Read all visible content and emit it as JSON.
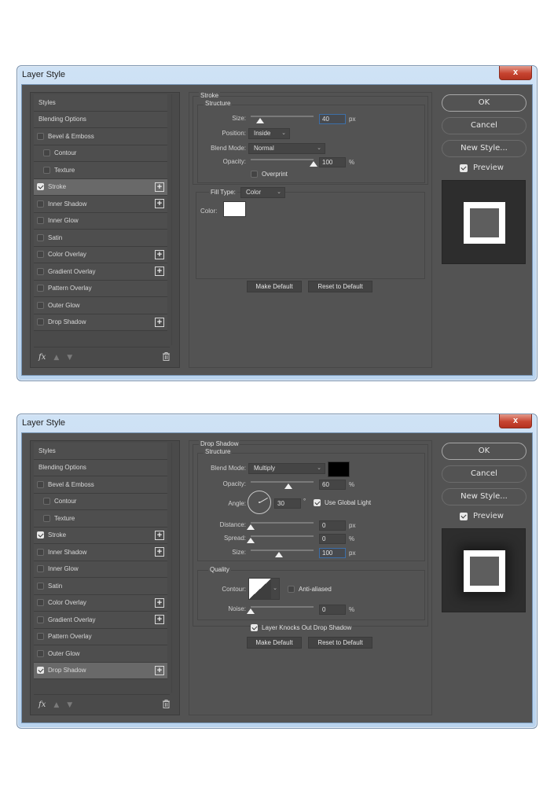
{
  "dialogs": [
    {
      "title": "Layer Style",
      "close_label": "x",
      "styles_list": [
        {
          "label": "Styles",
          "type": "plain"
        },
        {
          "label": "Blending Options",
          "type": "plain"
        },
        {
          "label": "Bevel & Emboss",
          "checked": false
        },
        {
          "label": "Contour",
          "checked": false,
          "sub": true
        },
        {
          "label": "Texture",
          "checked": false,
          "sub": true
        },
        {
          "label": "Stroke",
          "checked": true,
          "plus": true,
          "active": true
        },
        {
          "label": "Inner Shadow",
          "checked": false,
          "plus": true
        },
        {
          "label": "Inner Glow",
          "checked": false
        },
        {
          "label": "Satin",
          "checked": false
        },
        {
          "label": "Color Overlay",
          "checked": false,
          "plus": true
        },
        {
          "label": "Gradient Overlay",
          "checked": false,
          "plus": true
        },
        {
          "label": "Pattern Overlay",
          "checked": false
        },
        {
          "label": "Outer Glow",
          "checked": false
        },
        {
          "label": "Drop Shadow",
          "checked": false,
          "plus": true
        }
      ],
      "footer": {
        "fx_label": "fx",
        "up_icon": "▲",
        "down_icon": "▼",
        "trash_icon": "🗑"
      },
      "panel": {
        "section_title": "Stroke",
        "structure_title": "Structure",
        "size_label": "Size:",
        "size_value": "40",
        "size_unit": "px",
        "size_slider_fraction": 0.15,
        "position_label": "Position:",
        "position_value": "Inside",
        "blend_mode_label": "Blend Mode:",
        "blend_mode_value": "Normal",
        "opacity_label": "Opacity:",
        "opacity_value": "100",
        "opacity_unit": "%",
        "opacity_slider_fraction": 1.0,
        "overprint_label": "Overprint",
        "overprint_checked": false,
        "fill_type_label": "Fill Type:",
        "fill_type_value": "Color",
        "color_label": "Color:",
        "color_value": "#ffffff",
        "make_default": "Make Default",
        "reset_default": "Reset to Default"
      },
      "buttons": {
        "ok": "OK",
        "cancel": "Cancel",
        "new_style": "New Style...",
        "preview": "Preview",
        "preview_checked": true
      }
    },
    {
      "title": "Layer Style",
      "close_label": "x",
      "styles_list": [
        {
          "label": "Styles",
          "type": "plain"
        },
        {
          "label": "Blending Options",
          "type": "plain"
        },
        {
          "label": "Bevel & Emboss",
          "checked": false
        },
        {
          "label": "Contour",
          "checked": false,
          "sub": true
        },
        {
          "label": "Texture",
          "checked": false,
          "sub": true
        },
        {
          "label": "Stroke",
          "checked": true,
          "plus": true
        },
        {
          "label": "Inner Shadow",
          "checked": false,
          "plus": true
        },
        {
          "label": "Inner Glow",
          "checked": false
        },
        {
          "label": "Satin",
          "checked": false
        },
        {
          "label": "Color Overlay",
          "checked": false,
          "plus": true
        },
        {
          "label": "Gradient Overlay",
          "checked": false,
          "plus": true
        },
        {
          "label": "Pattern Overlay",
          "checked": false
        },
        {
          "label": "Outer Glow",
          "checked": false
        },
        {
          "label": "Drop Shadow",
          "checked": true,
          "plus": true,
          "active": true
        }
      ],
      "footer": {
        "fx_label": "fx",
        "up_icon": "▲",
        "down_icon": "▼",
        "trash_icon": "🗑"
      },
      "panel": {
        "section_title": "Drop Shadow",
        "structure_title": "Structure",
        "blend_mode_label": "Blend Mode:",
        "blend_mode_value": "Multiply",
        "shadow_color": "#000000",
        "opacity_label": "Opacity:",
        "opacity_value": "60",
        "opacity_unit": "%",
        "opacity_slider_fraction": 0.6,
        "angle_label": "Angle:",
        "angle_value": "30",
        "angle_unit": "°",
        "global_light_label": "Use Global Light",
        "global_light_checked": true,
        "distance_label": "Distance:",
        "distance_value": "0",
        "distance_unit": "px",
        "distance_slider_fraction": 0,
        "spread_label": "Spread:",
        "spread_value": "0",
        "spread_unit": "%",
        "spread_slider_fraction": 0,
        "size_label": "Size:",
        "size_value": "100",
        "size_unit": "px",
        "size_slider_fraction": 0.45,
        "quality_title": "Quality",
        "contour_label": "Contour:",
        "anti_aliased_label": "Anti-aliased",
        "anti_aliased_checked": false,
        "noise_label": "Noise:",
        "noise_value": "0",
        "noise_unit": "%",
        "noise_slider_fraction": 0,
        "knockout_label": "Layer Knocks Out Drop Shadow",
        "knockout_checked": true,
        "make_default": "Make Default",
        "reset_default": "Reset to Default"
      },
      "buttons": {
        "ok": "OK",
        "cancel": "Cancel",
        "new_style": "New Style...",
        "preview": "Preview",
        "preview_checked": true
      }
    }
  ]
}
